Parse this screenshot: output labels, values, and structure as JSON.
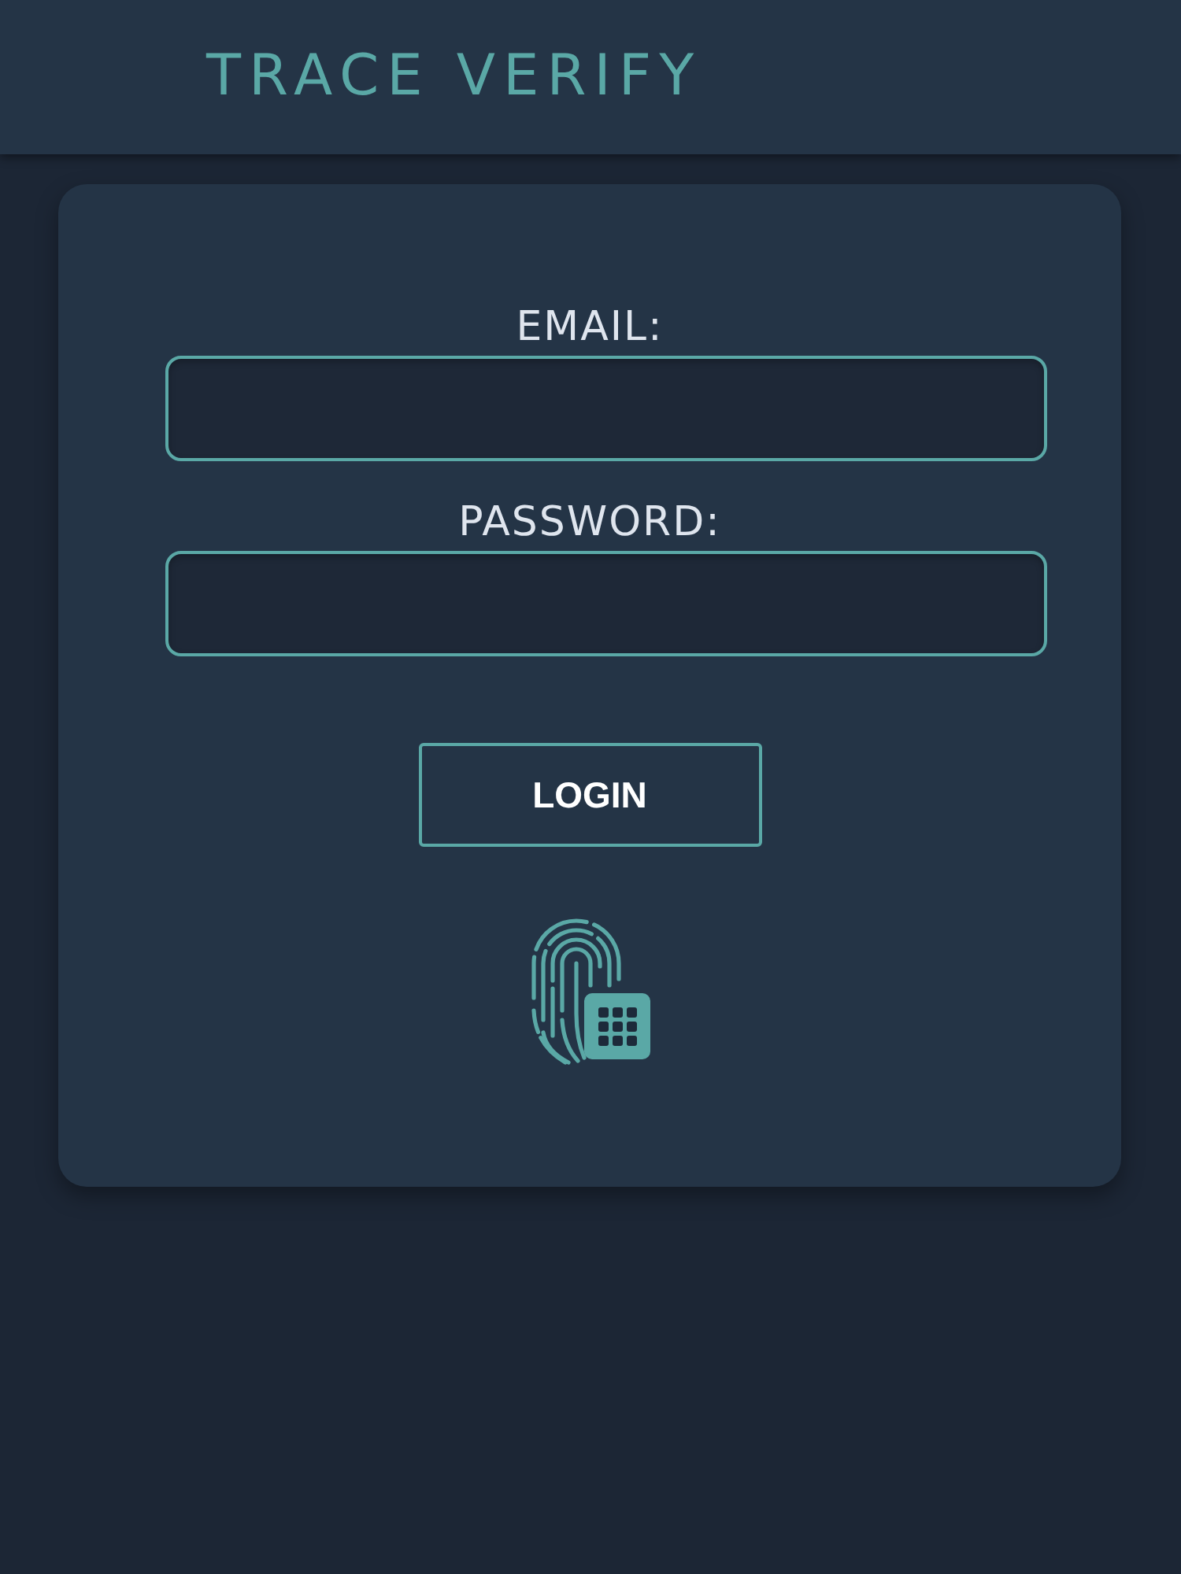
{
  "header": {
    "title": "TRACE VERIFY"
  },
  "login_form": {
    "fields": [
      {
        "label": "EMAIL:"
      },
      {
        "label": "PASSWORD:"
      }
    ],
    "submit_button": "LOGIN"
  }
}
